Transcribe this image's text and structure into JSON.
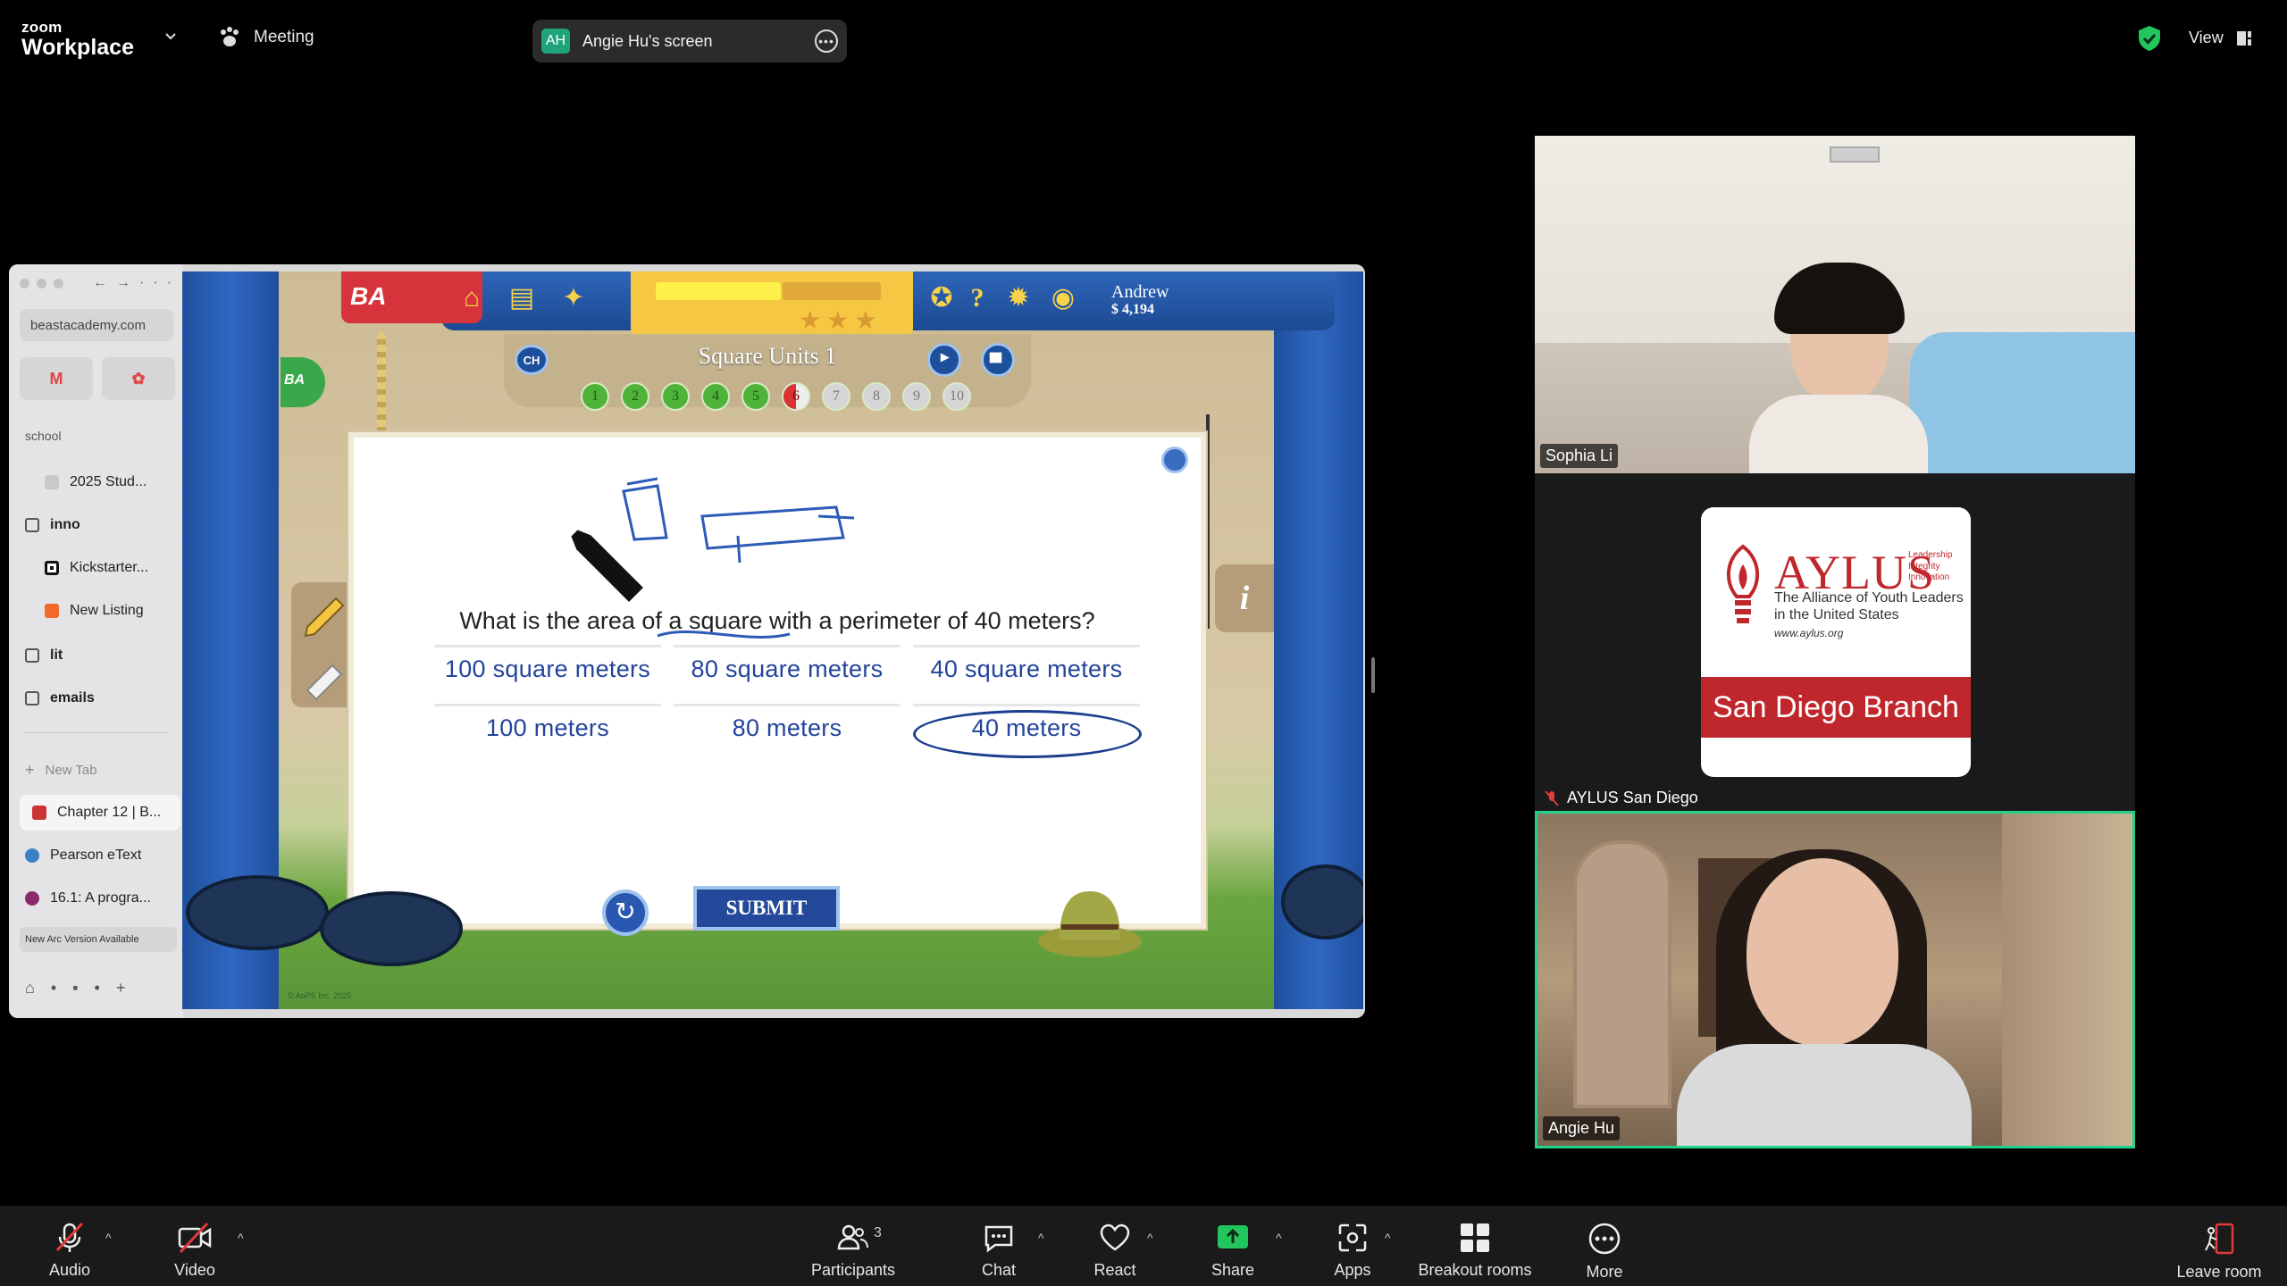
{
  "app": {
    "brand_small": "zoom",
    "brand_big": "Workplace",
    "meeting_label": "Meeting",
    "shared_screen": {
      "initials": "AH",
      "label": "Angie Hu's screen"
    },
    "view_label": "View"
  },
  "browser": {
    "url": "beastacademy.com",
    "section_label": "school",
    "items": [
      {
        "label": "2025 Stud...",
        "type": "page"
      },
      {
        "label": "inno",
        "type": "folder"
      },
      {
        "label": "Kickstarter...",
        "type": "page"
      },
      {
        "label": "New Listing",
        "type": "page"
      },
      {
        "label": "lit",
        "type": "folder"
      },
      {
        "label": "emails",
        "type": "folder"
      }
    ],
    "new_tab": "New Tab",
    "tabs": [
      {
        "label": "Chapter 12 | B..."
      },
      {
        "label": "Pearson eText"
      },
      {
        "label": "16.1: A progra..."
      }
    ],
    "update_notice": "New Arc Version Available"
  },
  "game": {
    "brand": "BA",
    "side_brand": "BA",
    "user_name": "Andrew",
    "coins": "4,194",
    "chapter_badge": "CH",
    "lesson_title": "Square Units 1",
    "steps": [
      "1",
      "2",
      "3",
      "4",
      "5",
      "6",
      "7",
      "8",
      "9",
      "10"
    ],
    "current_step": 6,
    "question": "What is the area of a square with a perimeter of 40 meters?",
    "choices": [
      {
        "label": "100 square meters"
      },
      {
        "label": "80 square meters"
      },
      {
        "label": "40 square meters"
      },
      {
        "label": "100 meters"
      },
      {
        "label": "80 meters"
      },
      {
        "label": "40 meters"
      }
    ],
    "selected_choice": 5,
    "submit_label": "SUBMIT",
    "info_label": "i",
    "copyright": "© AoPS Inc. 2025"
  },
  "participants": [
    {
      "name": "Sophia Li"
    },
    {
      "name": "AYLUS San Diego",
      "muted": true
    },
    {
      "name": "Angie Hu",
      "active_speaker": true
    }
  ],
  "aylus_logo": {
    "title": "AYLUS",
    "tagline": [
      "Leadership",
      "Integrity",
      "Innovation"
    ],
    "subtitle_1": "The Alliance of Youth Leaders",
    "subtitle_2": "in the United States",
    "website": "www.aylus.org",
    "branch": "San Diego Branch"
  },
  "toolbar": {
    "audio": "Audio",
    "video": "Video",
    "participants": "Participants",
    "participants_count": "3",
    "chat": "Chat",
    "react": "React",
    "share": "Share",
    "apps": "Apps",
    "breakout": "Breakout rooms",
    "more": "More",
    "leave": "Leave room"
  },
  "colors": {
    "active_speaker": "#23d18b",
    "share_green": "#23c55e",
    "mute_red": "#e23b3b",
    "aylus_red": "#c0272d"
  }
}
